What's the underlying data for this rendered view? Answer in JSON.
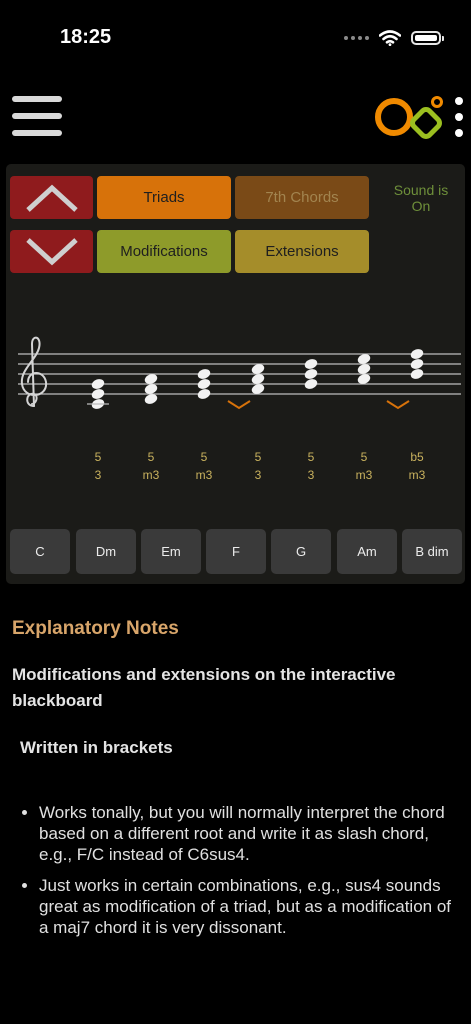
{
  "status_bar": {
    "time": "18:25"
  },
  "logo": {
    "colors": [
      "#f08a00",
      "#9bbf20",
      "#f08a00"
    ]
  },
  "board": {
    "buttons": {
      "triads": "Triads",
      "seventh_chords": "7th Chords",
      "modifications": "Modifications",
      "extensions": "Extensions"
    },
    "sound_status": "Sound is On",
    "intervals": [
      {
        "top": "5",
        "bottom": "3"
      },
      {
        "top": "5",
        "bottom": "m3"
      },
      {
        "top": "5",
        "bottom": "m3"
      },
      {
        "top": "5",
        "bottom": "3"
      },
      {
        "top": "5",
        "bottom": "3"
      },
      {
        "top": "5",
        "bottom": "m3"
      },
      {
        "top": "b5",
        "bottom": "m3"
      }
    ],
    "chords": [
      "C",
      "Dm",
      "Em",
      "F",
      "G",
      "Am",
      "B dim"
    ],
    "colors": {
      "arrow": "#8f1b1d",
      "triads": "#d7720a",
      "seventh_chords": "#7a4a17",
      "modifications": "#8e9b2a",
      "extensions": "#a58d2a",
      "marker": "#d7720a"
    }
  },
  "notes": {
    "title": "Explanatory Notes",
    "subtitle": "Modifications and extensions on the interactive blackboard",
    "heading": "Written in brackets",
    "items": [
      "Works tonally, but you will normally interpret the chord based on a different root and write it as slash chord, e.g., F/C instead of C6sus4.",
      "Just works in certain combinations, e.g., sus4 sounds great as modification of a triad, but as a modification of a maj7 chord it is very dissonant."
    ]
  }
}
